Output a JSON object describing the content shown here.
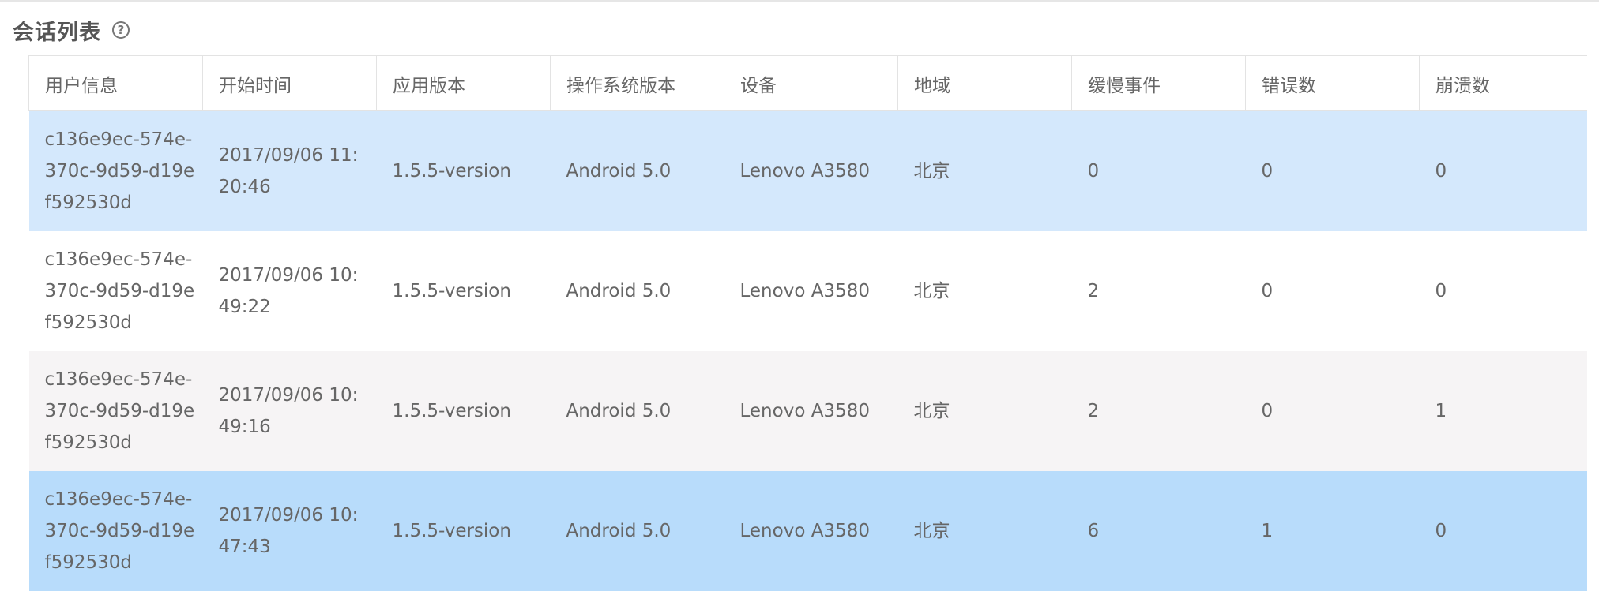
{
  "header": {
    "title": "会话列表",
    "help_glyph": "?"
  },
  "table": {
    "columns": [
      "用户信息",
      "开始时间",
      "应用版本",
      "操作系统版本",
      "设备",
      "地域",
      "缓慢事件",
      "错误数",
      "崩溃数"
    ],
    "rows": [
      {
        "user": "c136e9ec-574e-370c-9d59-d19ef592530d",
        "start_time": "2017/09/06 11:20:46",
        "app_version": "1.5.5-version",
        "os_version": "Android 5.0",
        "device": "Lenovo A3580",
        "region": "北京",
        "slow_events": "0",
        "errors": "0",
        "crashes": "0"
      },
      {
        "user": "c136e9ec-574e-370c-9d59-d19ef592530d",
        "start_time": "2017/09/06 10:49:22",
        "app_version": "1.5.5-version",
        "os_version": "Android 5.0",
        "device": "Lenovo A3580",
        "region": "北京",
        "slow_events": "2",
        "errors": "0",
        "crashes": "0"
      },
      {
        "user": "c136e9ec-574e-370c-9d59-d19ef592530d",
        "start_time": "2017/09/06 10:49:16",
        "app_version": "1.5.5-version",
        "os_version": "Android 5.0",
        "device": "Lenovo A3580",
        "region": "北京",
        "slow_events": "2",
        "errors": "0",
        "crashes": "1"
      },
      {
        "user": "c136e9ec-574e-370c-9d59-d19ef592530d",
        "start_time": "2017/09/06 10:47:43",
        "app_version": "1.5.5-version",
        "os_version": "Android 5.0",
        "device": "Lenovo A3580",
        "region": "北京",
        "slow_events": "6",
        "errors": "1",
        "crashes": "0"
      }
    ]
  },
  "colors": {
    "row_selected": "#d4e8fc",
    "row_plain": "#ffffff",
    "row_muted": "#f6f4f5",
    "row_hover": "#b8dcfb",
    "text": "#666666",
    "border": "#e3e3e3"
  }
}
